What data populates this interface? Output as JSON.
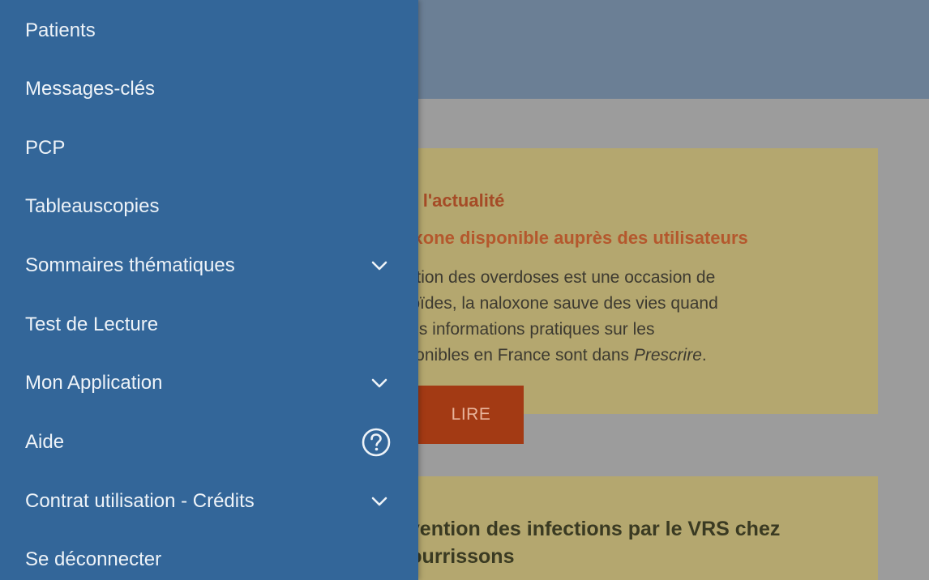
{
  "colors": {
    "drawer_background": "#336699",
    "drawer_text": "#eef3f8",
    "card_background": "#b4a76f",
    "accent_red": "#a33a14"
  },
  "drawer": {
    "items": [
      {
        "label": "Patients",
        "icon": null
      },
      {
        "label": "Messages-clés",
        "icon": null
      },
      {
        "label": "PCP",
        "icon": null
      },
      {
        "label": "Tableauscopies",
        "icon": null
      },
      {
        "label": "Sommaires thématiques",
        "icon": "chevron-down-icon"
      },
      {
        "label": "Test de Lecture",
        "icon": null
      },
      {
        "label": "Mon Application",
        "icon": "chevron-down-icon"
      },
      {
        "label": "Aide",
        "icon": "help-circle-icon"
      },
      {
        "label": "Contrat utilisation - Crédits",
        "icon": "chevron-down-icon"
      },
      {
        "label": "Se déconnecter",
        "icon": null
      }
    ]
  },
  "content": {
    "news_card": {
      "title": "ns l'actualité",
      "subtitle": "loxone disponible auprès des utilisateurs",
      "body_lines": [
        "ention des overdoses est une occasion de",
        "pioïdes, la naloxone sauve des vies quand",
        "Des informations pratiques sur les",
        "sponibles en France sont dans "
      ],
      "body_emphasis": "Prescrire",
      "body_end": ".",
      "button_label": "LIRE"
    },
    "second_card": {
      "title_lines": [
        "évention des infections par le VRS chez",
        "nourrissons"
      ]
    }
  }
}
